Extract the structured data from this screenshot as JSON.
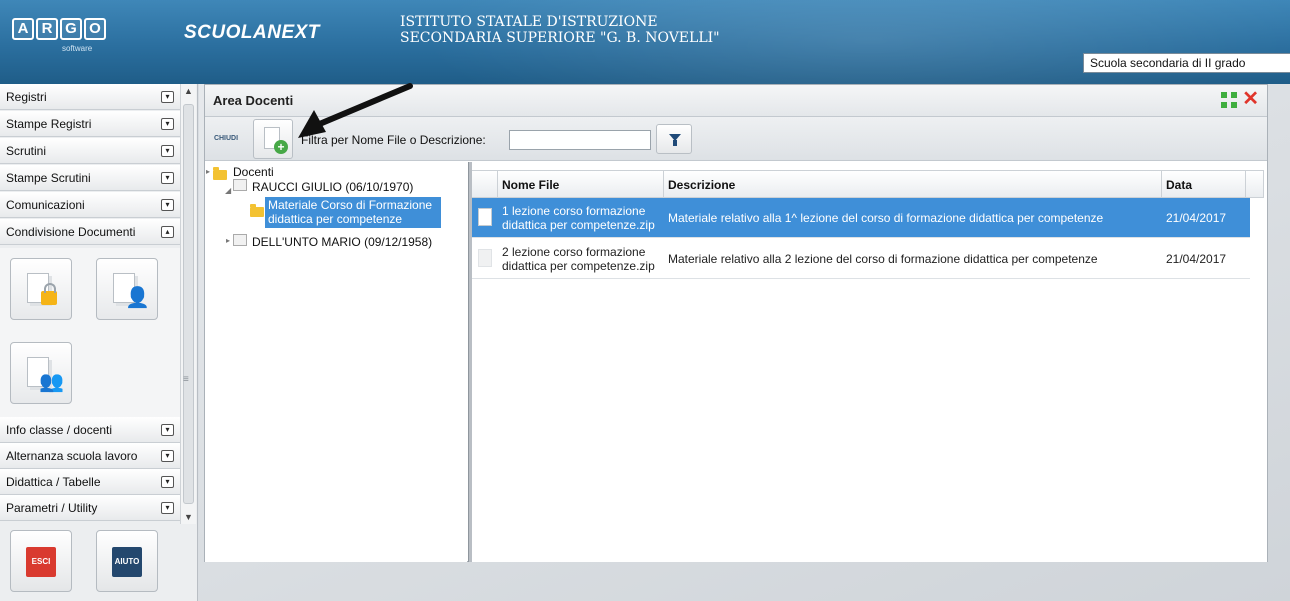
{
  "header": {
    "logo_letters": [
      "A",
      "R",
      "G",
      "O"
    ],
    "logo_sub": "software",
    "product": "SCUOLANEXT",
    "school_line1": "ISTITUTO STATALE D'ISTRUZIONE",
    "school_line2": "SECONDARIA SUPERIORE \"G. B. NOVELLI\"",
    "school_type": "Scuola secondaria di II grado"
  },
  "sidebar": {
    "items_top": [
      {
        "label": "Registri"
      },
      {
        "label": "Stampe Registri"
      },
      {
        "label": "Scrutini"
      },
      {
        "label": "Stampe Scrutini"
      },
      {
        "label": "Comunicazioni"
      },
      {
        "label": "Condivisione Documenti"
      }
    ],
    "items_bottom": [
      {
        "label": "Info classe / docenti"
      },
      {
        "label": "Alternanza scuola lavoro"
      },
      {
        "label": "Didattica / Tabelle"
      },
      {
        "label": "Parametri / Utility"
      }
    ],
    "esci_label": "ESCI",
    "aiuto_label": "AIUTO"
  },
  "window": {
    "title": "Area Docenti",
    "chiudi_label": "CHIUDI",
    "filter_label": "Filtra per Nome File o Descrizione:",
    "filter_value": ""
  },
  "tree": {
    "root": "Docenti",
    "teacher1": "RAUCCI GIULIO (06/10/1970)",
    "folder_line1": "Materiale Corso di Formazione",
    "folder_line2": "didattica per competenze",
    "teacher2": "DELL'UNTO MARIO (09/12/1958)"
  },
  "table": {
    "columns": [
      "Nome File",
      "Descrizione",
      "Data"
    ],
    "rows": [
      {
        "name_line1": "1 lezione corso formazione",
        "name_line2": "didattica per competenze.zip",
        "description": "Materiale relativo alla 1^ lezione del corso di formazione didattica per competenze",
        "date": "21/04/2017"
      },
      {
        "name_line1": "2 lezione corso formazione",
        "name_line2": "didattica per competenze.zip",
        "description": "Materiale relativo alla 2 lezione del corso di formazione didattica per competenze",
        "date": "21/04/2017"
      }
    ]
  },
  "colors": {
    "header_blue": "#2b6f9f",
    "selection_blue": "#3f8fd8",
    "close_red": "#e0352b",
    "esci_red": "#d93a2f",
    "aiuto_navy": "#24486e"
  }
}
